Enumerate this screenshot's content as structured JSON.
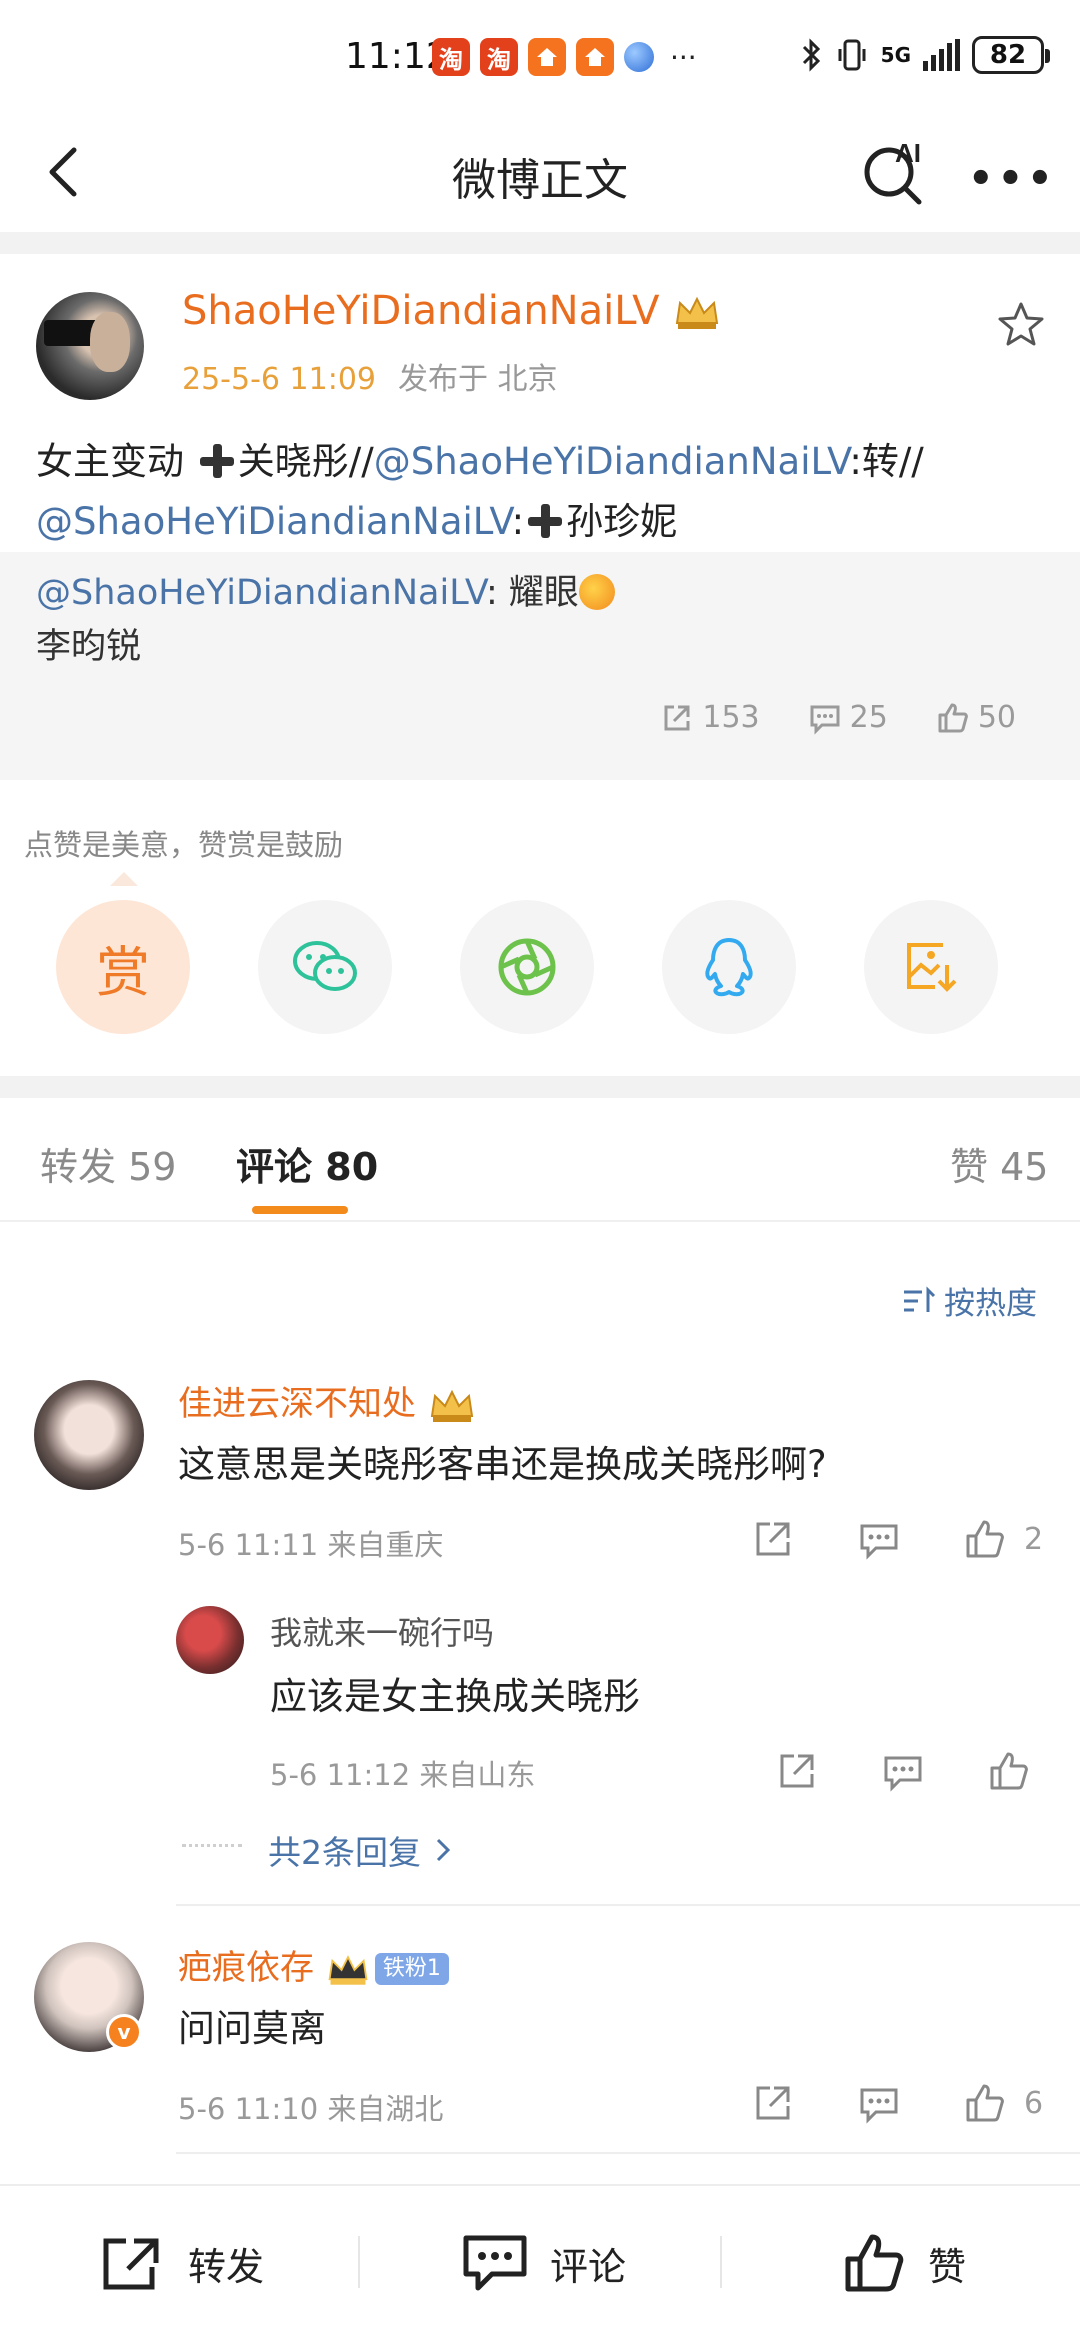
{
  "status_bar": {
    "time": "11:12",
    "app_badge_1": "淘",
    "app_badge_2": "淘",
    "more": "···",
    "battery": "82",
    "network": "5G"
  },
  "nav": {
    "title": "微博正文",
    "ai_label": "AI"
  },
  "post": {
    "author": "ShaoHeYiDiandianNaiLV",
    "time": "25-5-6 11:09",
    "location": "发布于 北京",
    "text_part1": "女主变动 ",
    "text_part2": "关晓彤//",
    "mention1": "@ShaoHeYiDiandianNaiLV",
    "text_part3": ":转//",
    "mention2": "@ShaoHeYiDiandianNaiLV",
    "text_part4": ":",
    "text_part5": "孙珍妮"
  },
  "repost": {
    "mention": "@ShaoHeYiDiandianNaiLV",
    "text": ": 耀眼",
    "line2": "李昀锐",
    "repost_count": "153",
    "comment_count": "25",
    "like_count": "50"
  },
  "reward": {
    "hint": "点赞是美意，赞赏是鼓励",
    "reward_label": "赏"
  },
  "tabs": {
    "repost_label": "转发",
    "repost_count": "59",
    "comment_label": "评论",
    "comment_count": "80",
    "like_label": "赞",
    "like_count": "45"
  },
  "sort": {
    "label": "按热度"
  },
  "comments": [
    {
      "name": "佳进云深不知处",
      "text": "这意思是关晓彤客串还是换成关晓彤啊?",
      "meta": "5-6 11:11 来自重庆",
      "likes": "2"
    },
    {
      "name": "疤痕依存",
      "fan_badge": "铁粉1",
      "text": "问问莫离",
      "meta": "5-6 11:10 来自湖北",
      "likes": "6"
    }
  ],
  "reply": {
    "name": "我就来一碗行吗",
    "text": "应该是女主换成关晓彤",
    "meta": "5-6 11:12 来自山东",
    "more": "共2条回复"
  },
  "bottom_bar": {
    "repost": "转发",
    "comment": "评论",
    "like": "赞"
  },
  "colors": {
    "accent_orange": "#e86d1f",
    "link_blue": "#4a74a8",
    "tab_underline": "#f28a1c",
    "wechat_green": "#2ec29a",
    "moments_green": "#6cc24a",
    "qq_blue": "#33aaf0",
    "save_orange": "#f5a623"
  }
}
